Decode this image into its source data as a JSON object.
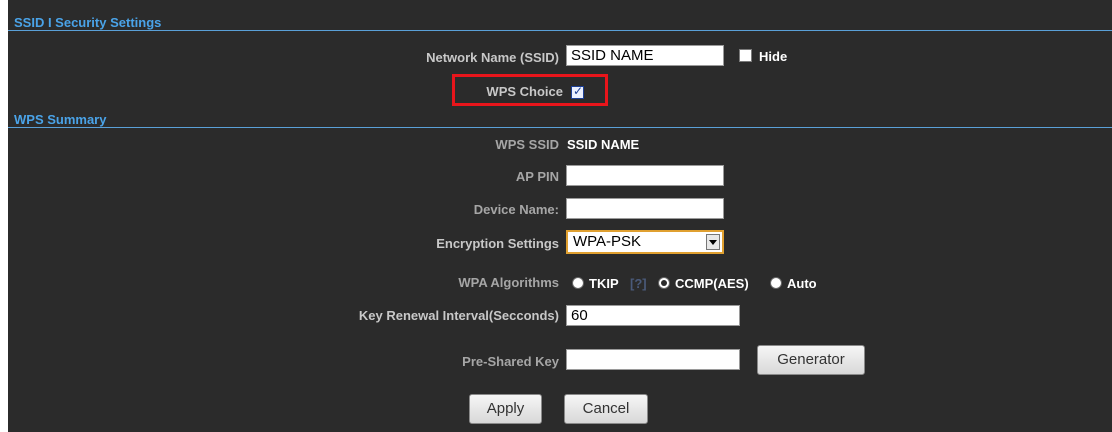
{
  "sections": {
    "ssid_security": {
      "title": "SSID I Security Settings"
    },
    "wps_summary": {
      "title": "WPS Summary"
    }
  },
  "ssid": {
    "network_name_label": "Network Name (SSID)",
    "network_name_value": "SSID NAME",
    "hide_label": "Hide",
    "hide_checked": false,
    "wps_choice_label": "WPS Choice",
    "wps_choice_checked": true
  },
  "wps": {
    "wps_ssid_label": "WPS SSID",
    "wps_ssid_value": "SSID NAME",
    "ap_pin_label": "AP PIN",
    "ap_pin_value": "",
    "device_name_label": "Device Name:",
    "device_name_value": "",
    "encryption_label": "Encryption Settings",
    "encryption_value": "WPA-PSK",
    "wpa_algorithms_label": "WPA Algorithms",
    "algorithms": [
      {
        "label": "TKIP",
        "checked": false
      },
      {
        "label": "CCMP(AES)",
        "checked": true
      },
      {
        "label": "Auto",
        "checked": false
      }
    ],
    "help_text": "[?]",
    "key_renewal_label": "Key Renewal Interval(Secconds)",
    "key_renewal_value": "60",
    "psk_label": "Pre-Shared Key",
    "psk_value": "",
    "generator_label": "Generator"
  },
  "actions": {
    "apply_label": "Apply",
    "cancel_label": "Cancel"
  },
  "colors": {
    "background": "#2b2b2b",
    "section_title": "#4aa3e8",
    "highlight": "#e8151b"
  }
}
